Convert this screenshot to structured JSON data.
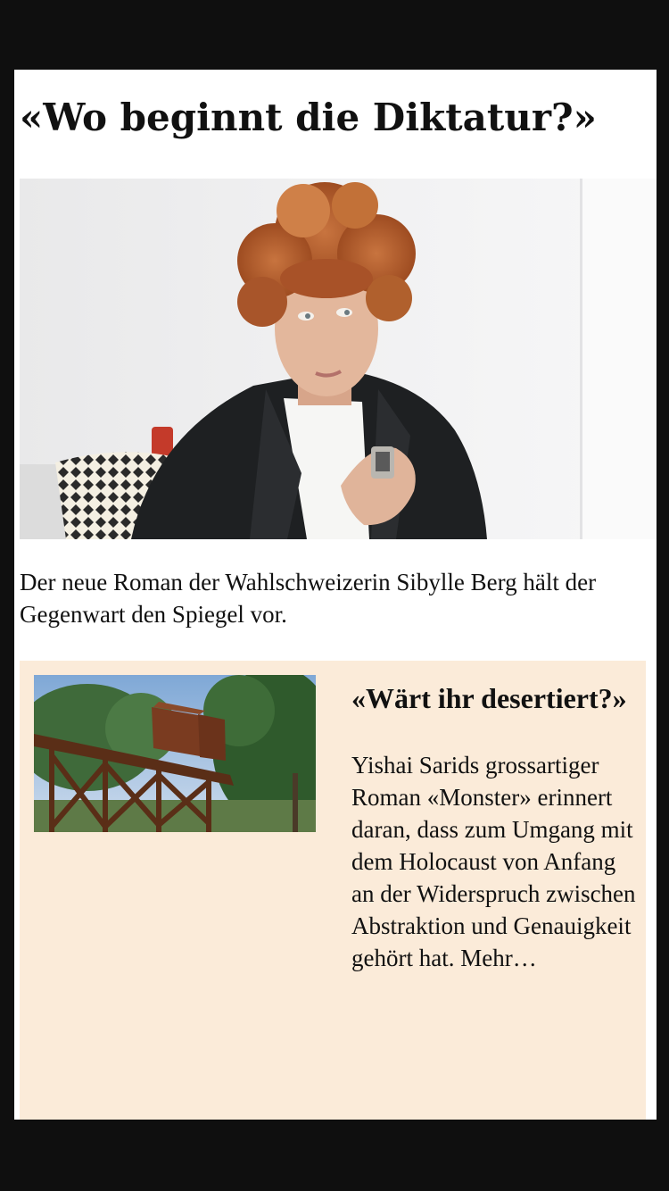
{
  "article": {
    "title": "«Wo beginnt die Diktatur?»",
    "lead": "Der neue Roman der Wahlschweizerin Sibylle Berg hält der Gegenwart den Spiegel vor."
  },
  "teaser": {
    "title": "«Wärt ihr desertiert?»",
    "body": "Yishai Sarids grossartiger Roman «Monster» erinnert daran, dass zum Umgang mit dem Holocaust von Anfang an der Widerspruch zwischen Abstraktion und Genauigkeit gehört hat.",
    "more": "Mehr…"
  },
  "colors": {
    "outer_background": "#0f0f0f",
    "page_background": "#ffffff",
    "teaser_background": "#fbebd9",
    "text": "#111111"
  }
}
